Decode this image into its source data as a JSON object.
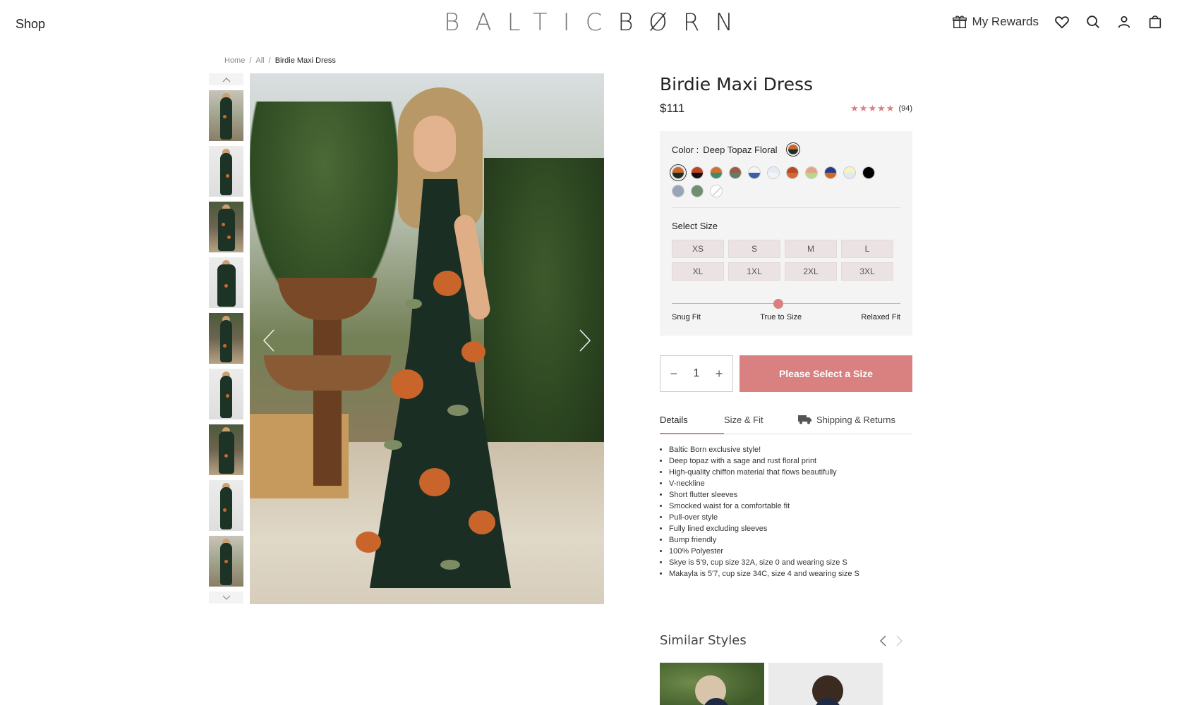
{
  "header": {
    "shop_label": "Shop",
    "logo_light": "BALTIC",
    "logo_dark": "BØRN",
    "rewards_label": "My Rewards",
    "icons": [
      "gift-icon",
      "heart-icon",
      "search-icon",
      "user-icon",
      "bag-icon"
    ]
  },
  "breadcrumb": {
    "home": "Home",
    "sep1": "/",
    "all": "All",
    "sep2": "/",
    "current": "Birdie Maxi Dress"
  },
  "product": {
    "title": "Birdie Maxi Dress",
    "price": "$111",
    "stars": "★★★★★",
    "review_count": "(94)",
    "color_label": "Color :",
    "color_name": "Deep Topaz Floral",
    "swatches": [
      {
        "top": "#c8692b",
        "bottom": "#1b2e24",
        "active": true
      },
      {
        "top": "#c2421f",
        "bottom": "#111111"
      },
      {
        "top": "#d1702f",
        "bottom": "#3f8a6e"
      },
      {
        "top": "#9c5a44",
        "bottom": "#5f7f6a"
      },
      {
        "top": "#f4f4f4",
        "bottom": "#3a5fa8"
      },
      {
        "top": "#e3ecf7",
        "bottom": "#f4f4f4"
      },
      {
        "top": "#b84a1f",
        "bottom": "#d2683a"
      },
      {
        "top": "#e6a289",
        "bottom": "#b8d68a"
      },
      {
        "top": "#2a3a8a",
        "bottom": "#d06a20"
      },
      {
        "top": "#f6f2c4",
        "bottom": "#dde9f6"
      },
      {
        "top": "#000000",
        "bottom": "#000000"
      },
      {
        "top": "#98a5b6",
        "bottom": "#98a5b6"
      },
      {
        "top": "#6f8f70",
        "bottom": "#6f8f70"
      },
      {
        "top": "#ffffff",
        "bottom": "#ffffff",
        "none": true
      }
    ],
    "size_label": "Select Size",
    "sizes": [
      "XS",
      "S",
      "M",
      "L",
      "XL",
      "1XL",
      "2XL",
      "3XL"
    ],
    "fit_labels": [
      "Snug Fit",
      "True to Size",
      "Relaxed Fit"
    ],
    "fit_value": 0.5,
    "quantity": "1",
    "qty_minus": "−",
    "qty_plus": "+",
    "add_label": "Please Select a Size"
  },
  "tabs": [
    "Details",
    "Size & Fit",
    "Shipping & Returns"
  ],
  "details": [
    "Baltic Born exclusive style!",
    "Deep topaz with a sage and rust floral print",
    "High-quality chiffon material that flows beautifully",
    "V-neckline",
    "Short flutter sleeves",
    "Smocked waist for a comfortable fit",
    "Pull-over style",
    "Fully lined excluding sleeves",
    "Bump friendly",
    "100% Polyester",
    "Skye is 5'9, cup size 32A, size 0 and wearing size S",
    "Makayla is 5'7, cup size 34C, size 4 and wearing size S"
  ],
  "similar": {
    "title": "Similar Styles"
  },
  "colors": {
    "accent": "#d98080",
    "option_bg": "#f4f4f4"
  }
}
